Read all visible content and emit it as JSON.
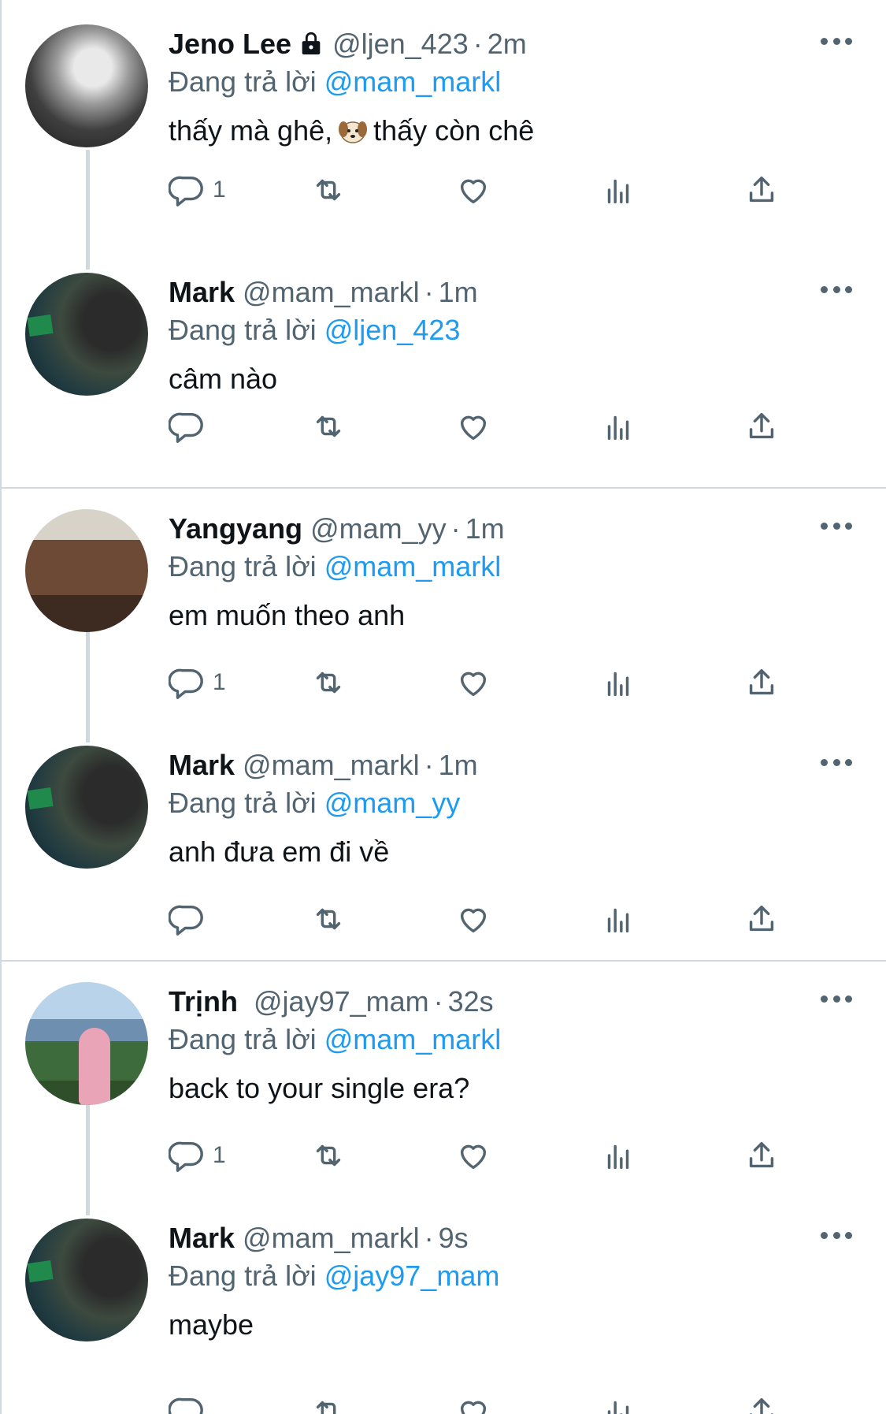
{
  "common": {
    "replying_prefix": "Đang trả lời",
    "more_glyph": "•••"
  },
  "tweets": [
    {
      "name": "Jeno Lee",
      "handle": "@ljen_423",
      "time": "2m",
      "protected": true,
      "replying_to": "@mam_markl",
      "text_before": "thấy mà ghê,",
      "text_after": "thấy còn chê",
      "emoji": "dog-face-emoji",
      "reply_count": "1"
    },
    {
      "name": "Mark",
      "handle": "@mam_markl",
      "time": "1m",
      "replying_to": "@ljen_423",
      "text": "câm nào",
      "reply_count": ""
    },
    {
      "name": "Yangyang",
      "handle": "@mam_yy",
      "time": "1m",
      "replying_to": "@mam_markl",
      "text": "em muốn theo anh",
      "reply_count": "1"
    },
    {
      "name": "Mark",
      "handle": "@mam_markl",
      "time": "1m",
      "replying_to": "@mam_yy",
      "text": "anh đưa em đi về",
      "reply_count": ""
    },
    {
      "name": "Trịnh",
      "handle": "@jay97_mam",
      "time": "32s",
      "replying_to": "@mam_markl",
      "text": "back to your single era?",
      "reply_count": "1"
    },
    {
      "name": "Mark",
      "handle": "@mam_markl",
      "time": "9s",
      "replying_to": "@jay97_mam",
      "text": "maybe",
      "reply_count": ""
    }
  ],
  "colors": {
    "link": "#1d9bf0",
    "secondary": "#536471",
    "primary_text": "#0f1419",
    "divider": "#cfd9de"
  }
}
